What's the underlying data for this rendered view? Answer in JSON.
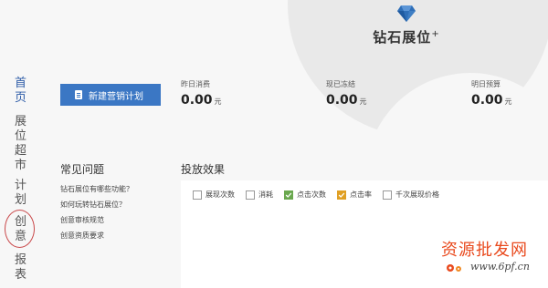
{
  "header": {
    "brand_icon": "diamond-icon",
    "title": "钻石展位",
    "title_sup": "+"
  },
  "nav": {
    "items": [
      {
        "label": "首页",
        "active": true
      },
      {
        "label": "展位超市",
        "active": false
      },
      {
        "label": "计划",
        "active": false
      },
      {
        "label": "创意",
        "active": false
      },
      {
        "label": "报表",
        "active": false
      }
    ]
  },
  "create_button": {
    "label": "新建营销计划",
    "icon": "document-icon"
  },
  "stats": [
    {
      "label": "昨日消费",
      "value": "0.00",
      "unit": "元"
    },
    {
      "label": "现已冻结",
      "value": "0.00",
      "unit": "元"
    },
    {
      "label": "明日预算",
      "value": "0.00",
      "unit": "元"
    }
  ],
  "faq": {
    "title": "常见问题",
    "links": [
      "钻石展位有哪些功能？",
      "如何玩转钻石展位？",
      "创意审核规范",
      "创意资质要求"
    ]
  },
  "results": {
    "title": "投放效果",
    "metrics": [
      {
        "label": "展现次数",
        "checked": false,
        "color": ""
      },
      {
        "label": "消耗",
        "checked": false,
        "color": ""
      },
      {
        "label": "点击次数",
        "checked": true,
        "color": "#6aa84f"
      },
      {
        "label": "点击率",
        "checked": true,
        "color": "#e0a024"
      },
      {
        "label": "千次展现价格",
        "checked": false,
        "color": ""
      }
    ]
  },
  "watermark": {
    "text": "资源批发网",
    "url": "www.6pf.cn"
  },
  "colors": {
    "accent": "#3b77c4",
    "nav_active": "#2f5da8",
    "watermark": "#e94a1e",
    "highlight_circle": "#c9484a"
  }
}
